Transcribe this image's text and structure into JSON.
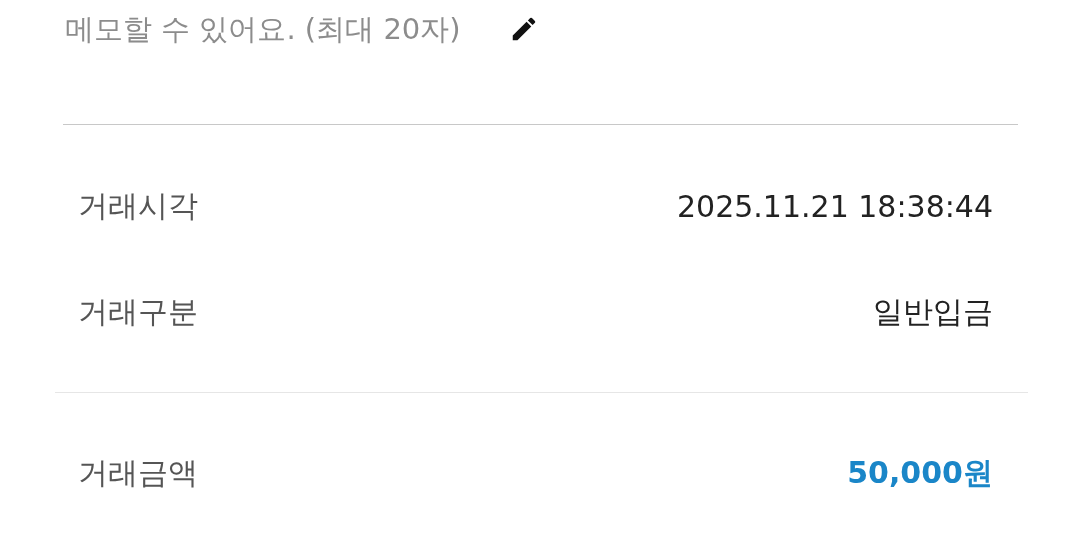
{
  "memo": {
    "placeholder": "메모할 수 있어요. (최대 20자)"
  },
  "details": [
    {
      "label": "거래시각",
      "value": "2025.11.21 18:38:44"
    },
    {
      "label": "거래구분",
      "value": "일반입금"
    }
  ],
  "total": {
    "label": "거래금액",
    "value": "50,000원"
  }
}
